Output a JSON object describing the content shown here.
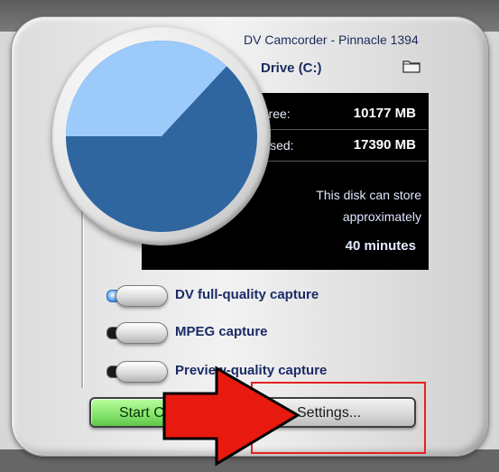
{
  "window": {
    "device_title": "DV Camcorder - Pinnacle 1394"
  },
  "drive": {
    "label": "Drive (C:)",
    "icon": "folder-icon"
  },
  "disk_usage": {
    "free_label": "Free:",
    "free_value": "10177 MB",
    "used_label": "Used:",
    "used_value": "17390 MB",
    "free_mb": 10177,
    "used_mb": 17390
  },
  "storage_message": {
    "line1": "This disk can store",
    "line2": "approximately",
    "duration": "40 minutes"
  },
  "capture_options": [
    {
      "label": "DV full-quality capture",
      "selected": true
    },
    {
      "label": "MPEG capture",
      "selected": false
    },
    {
      "label": "Preview-quality capture",
      "selected": false
    }
  ],
  "buttons": {
    "start_label": "Start Capture",
    "settings_label": "Settings..."
  },
  "colors": {
    "free_slice": "#9ccafa",
    "used_slice": "#2f66a0",
    "highlight": "#e62020",
    "arrow": "#e8190f"
  }
}
